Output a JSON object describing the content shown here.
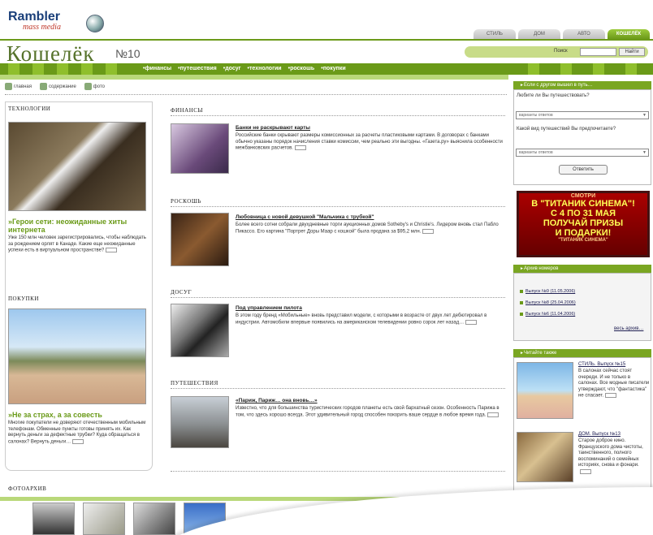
{
  "header": {
    "logo_text": "Rambler",
    "logo_sub": "mass media",
    "brand": "Кошелёк",
    "issue": "№10",
    "tabs": [
      "СТИЛЬ",
      "ДОМ",
      "АВТО",
      "КОШЕЛЁК"
    ],
    "search_label": "Поиск",
    "search_button": "Найти"
  },
  "nav": {
    "items": [
      "финансы",
      "путешествия",
      "досуг",
      "технологии",
      "роскошь",
      "покупки"
    ]
  },
  "util": {
    "home": "главная",
    "contents": "содержание",
    "photo": "фото"
  },
  "left": {
    "tech_heading": "ТЕХНОЛОГИИ",
    "tech_title": "Герои сети: неожиданные хиты интернета",
    "tech_text": "Уже 150 млн человек зарегистрировались, чтобы наблюдать за рождением орлят в Канаде. Какие еще неожиданные успехи есть в виртуальном пространстве?",
    "shop_heading": "ПОКУПКИ",
    "shop_title": "Не за страх, а за совесть",
    "shop_text": "Многие покупатели не доверяют отечественным мобильным телефонам. Обменные пункты готовы принять их. Как вернуть деньги за дефектные трубки? Куда обращаться в салонах? Вернуть деньги…"
  },
  "center": {
    "fin_heading": "ФИНАНСЫ",
    "fin_title": "Банки не раскрывают карты",
    "fin_text": "Российские банки скрывают размеры комиссионных за расчеты пластиковыми картами. В договорах с банками обычно указаны порядок начисления ставки комиссии, чем реально эти выгодны. «Газета.ру» выяснила особенности межбанковских расчетов.",
    "lux_heading": "РОСКОШЬ",
    "lux_title": "Любовница с новой девушкой \"Мальчика с трубкой\"",
    "lux_text": "Более всего сотни собрали двухдневные торги аукционных домов Sotheby's и Christie's. Лидером вновь стал Пабло Пикассо. Его картина \"Портрет Доры Маар с кошкой\" была продана за $95,2 млн.",
    "leis_heading": "ДОСУГ",
    "leis_title": "Под управлением пилота",
    "leis_text": "В этом году бренд «Мобильные» вновь представил модели, с которыми в возрасте от двух лет дебютировал в индустрии. Автомобили впервые появились на американском телевидении ровно сорок лет назад…",
    "trav_heading": "ПУТЕШЕСТВИЯ",
    "trav_title": "«Париж, Париж… она вновь…»",
    "trav_text": "Известно, что для большинства туристических городов планеты есть свой бархатный сезон. Особенность Парижа в том, что здесь хорошо всегда. Этот удивительный город способен покорить ваше сердце в любое время года."
  },
  "right": {
    "poll_head": "Если с другом вышел в путь…",
    "poll_q1": "Любите ли Вы путешествовать?",
    "poll_sel": "варианты ответов",
    "poll_q2": "Какой вид путешествий Вы предпочитаете?",
    "poll_btn": "Ответить",
    "banner_l1": "СМОТРИ",
    "banner_l2": "В \"ТИТАНИК СИНЕМА\"!",
    "banner_l3": "С 4 ПО 31 МАЯ",
    "banner_l4": "ПОЛУЧАЙ ПРИЗЫ",
    "banner_l5": "И ПОДАРКИ!",
    "banner_l6": "\"ТИТАНИК СИНЕМА\"",
    "arch_head": "Архив номеров",
    "arch": [
      "Выпуск №9 (11.05.2006)",
      "Выпуск №8 (25.04.2006)",
      "Выпуск №6 (11.04.2006)"
    ],
    "arch_all": "весь архив…",
    "read_head": "Читайте также",
    "r1_title": "СТИЛЬ. Выпуск №15",
    "r1_text": "В салонах сейчас стоят очереди. И не только в салонах. Все модные писатели утверждают, что \"фантастика\" не спасает.",
    "r2_title": "ДОМ. Выпуск №13",
    "r2_text": "Старое доброе кино. Французского дома чистоты, таинственного, полного воспоминаний о семейных историях, снова и фонари."
  },
  "footer": {
    "heading": "ФОТОАРХИВ"
  }
}
